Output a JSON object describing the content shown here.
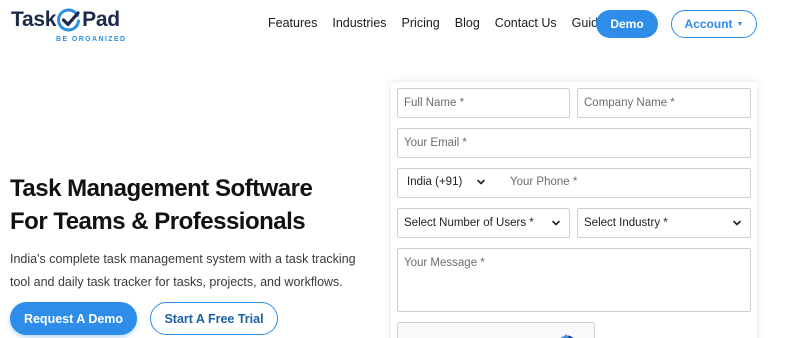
{
  "brand": {
    "name_left": "Task",
    "name_right": "Pad",
    "tagline": "BE ORGANIZED",
    "color_dark": "#1d2a4b",
    "color_accent": "#2a8fe4"
  },
  "nav": {
    "items": [
      "Features",
      "Industries",
      "Pricing",
      "Blog",
      "Contact Us",
      "Guide"
    ],
    "demo_label": "Demo",
    "account_label": "Account"
  },
  "hero": {
    "title_line1": "Task Management Software",
    "title_line2": "For Teams & Professionals",
    "subtitle_line1": "India's complete task management system with a task tracking",
    "subtitle_line2": "tool and daily task tracker for tasks, projects, and workflows.",
    "cta_primary": "Request A Demo",
    "cta_secondary": "Start A Free Trial"
  },
  "form": {
    "full_name_placeholder": "Full Name *",
    "company_name_placeholder": "Company Name *",
    "email_placeholder": "Your Email *",
    "country_code_selected": "India (+91)",
    "phone_placeholder": "Your Phone *",
    "users_select": "Select Number of Users *",
    "industry_select": "Select Industry *",
    "message_placeholder": "Your Message *"
  },
  "colors": {
    "primary": "#2e8de8",
    "text_dark": "#111111"
  },
  "icons": {
    "logo_check": "check-circle-icon",
    "dropdown": "chevron-down-icon",
    "recaptcha": "recaptcha-icon"
  }
}
